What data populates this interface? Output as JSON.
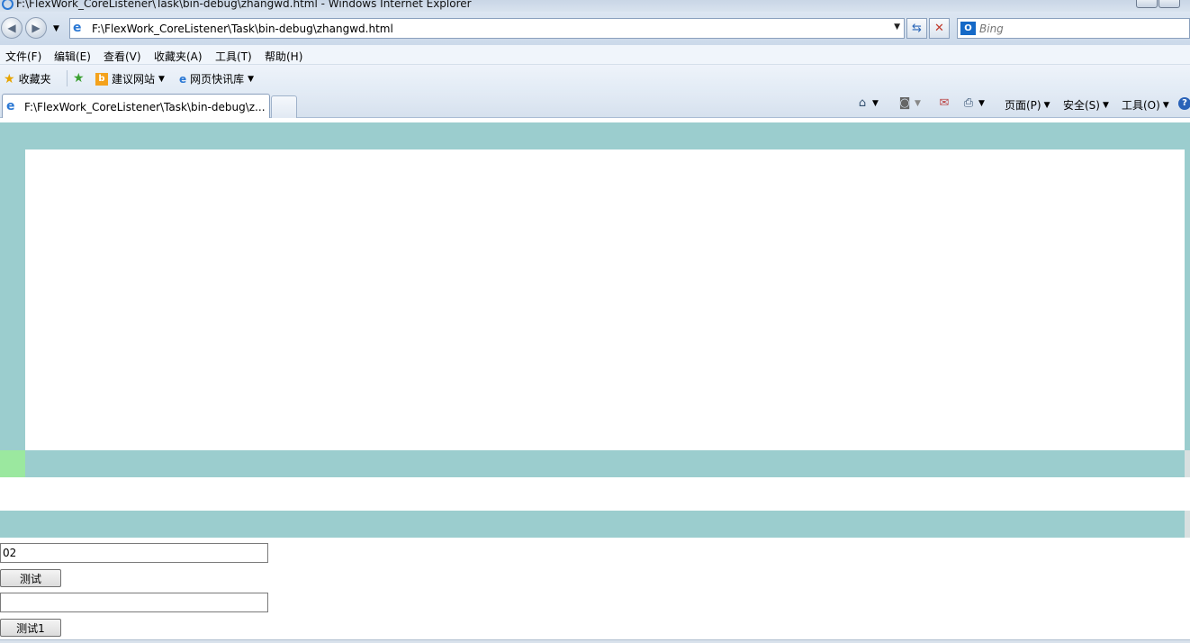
{
  "window": {
    "title": "F:\\FlexWork_CoreListener\\Task\\bin-debug\\zhangwd.html - Windows Internet Explorer"
  },
  "address_bar": {
    "url": "F:\\FlexWork_CoreListener\\Task\\bin-debug\\zhangwd.html",
    "dropdown_glyph": "▼",
    "refresh_glyph": "⇆",
    "stop_glyph": "✕"
  },
  "search": {
    "provider_badge": "O",
    "placeholder": "Bing"
  },
  "menu": {
    "items": [
      "文件(F)",
      "编辑(E)",
      "查看(V)",
      "收藏夹(A)",
      "工具(T)",
      "帮助(H)"
    ]
  },
  "favorites_bar": {
    "favorites_label": "收藏夹",
    "suggested_sites": "建议网站",
    "web_slice_gallery": "网页快讯库"
  },
  "tabs": [
    {
      "label": "F:\\FlexWork_CoreListener\\Task\\bin-debug\\z..."
    }
  ],
  "command_bar": {
    "page": "页面(P)",
    "safety": "安全(S)",
    "tools": "工具(O)",
    "help_glyph": "?"
  },
  "page": {
    "input1_value": "02",
    "button1_label": "测试",
    "input2_value": "",
    "button2_label": "测试1"
  },
  "colors": {
    "teal_band": "#9bcdce",
    "green_block": "#9be89f",
    "panel": "#ffffff"
  }
}
